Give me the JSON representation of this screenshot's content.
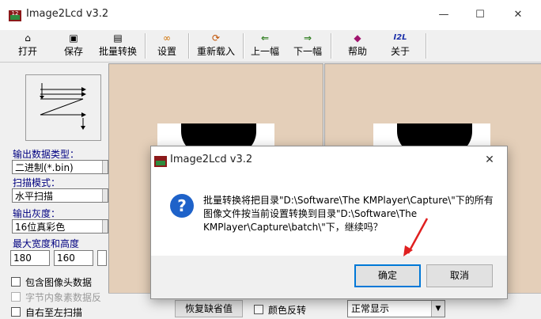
{
  "window": {
    "title": "Image2Lcd v3.2",
    "controls": {
      "minimize": "—",
      "maximize": "☐",
      "close": "✕"
    }
  },
  "toolbar": {
    "items": [
      {
        "label": "打开",
        "icon": "open-icon",
        "glyph": "⌂"
      },
      {
        "label": "保存",
        "icon": "save-icon",
        "glyph": "▣"
      },
      {
        "label": "批量转换",
        "icon": "batch-convert-icon",
        "glyph": "▤"
      },
      {
        "label": "设置",
        "icon": "settings-icon",
        "glyph": "∞"
      },
      {
        "label": "重新载入",
        "icon": "reload-icon",
        "glyph": "⟳"
      },
      {
        "label": "上一幅",
        "icon": "prev-arrow-icon",
        "glyph": "⇐"
      },
      {
        "label": "下一幅",
        "icon": "next-arrow-icon",
        "glyph": "⇒"
      },
      {
        "label": "帮助",
        "icon": "help-icon",
        "glyph": "◆"
      },
      {
        "label": "关于",
        "icon": "about-icon",
        "glyph": "I2L"
      }
    ]
  },
  "settings": {
    "output_type_label": "输出数据类型：",
    "output_type_value": "二进制(*.bin)",
    "scan_mode_label": "扫描模式：",
    "scan_mode_value": "水平扫描",
    "gray_label": "输出灰度：",
    "gray_value": "16位真彩色",
    "size_label": "最大宽度和高度",
    "width_value": "180",
    "height_value": "160",
    "checkboxes": [
      {
        "label": "包含图像头数据",
        "enabled": true
      },
      {
        "label": "字节内象素数据反",
        "enabled": false
      },
      {
        "label": "自右至左扫描",
        "enabled": true
      }
    ]
  },
  "bottom": {
    "restore_default": "恢复缺省值",
    "invert_color": "颜色反转",
    "display_mode": "正常显示"
  },
  "dialog": {
    "title": "Image2Lcd v3.2",
    "message": "批量转换将把目录\"D:\\Software\\The KMPlayer\\Capture\\\"下的所有图像文件按当前设置转换到目录\"D:\\Software\\The KMPlayer\\Capture\\batch\\\"下，继续吗？",
    "ok_label": "确定",
    "cancel_label": "取消",
    "close_glyph": "✕",
    "icon_glyph": "?"
  },
  "colors": {
    "preview_bg": "#e4cfb9",
    "accent": "#0078d7",
    "question_icon": "#1e62c9",
    "annotation_arrow": "#e02020"
  }
}
